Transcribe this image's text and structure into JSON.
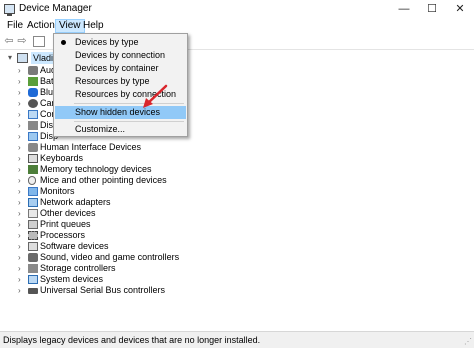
{
  "window": {
    "title": "Device Manager",
    "minimize_glyph": "—",
    "maximize_glyph": "☐",
    "close_glyph": "✕"
  },
  "menu": {
    "file": "File",
    "action": "Action",
    "view": "View",
    "help": "Help"
  },
  "view_menu": {
    "items": [
      {
        "label": "Devices by type",
        "selected": true
      },
      {
        "label": "Devices by connection"
      },
      {
        "label": "Devices by container"
      },
      {
        "label": "Resources by type"
      },
      {
        "label": "Resources by connection"
      },
      {
        "label": "Show hidden devices",
        "highlighted": true
      },
      {
        "label": "Customize..."
      }
    ]
  },
  "tree": {
    "root_label": "Vladimi",
    "partial_labels": [
      "Aud",
      "Batt",
      "Blue",
      "Cam",
      "Com",
      "Disk",
      "Disp"
    ],
    "items": [
      {
        "label": "Human Interface Devices",
        "icon": "hid-icon"
      },
      {
        "label": "Keyboards",
        "icon": "keyboard-icon"
      },
      {
        "label": "Memory technology devices",
        "icon": "memory-icon"
      },
      {
        "label": "Mice and other pointing devices",
        "icon": "mouse-icon"
      },
      {
        "label": "Monitors",
        "icon": "monitor-icon"
      },
      {
        "label": "Network adapters",
        "icon": "network-icon"
      },
      {
        "label": "Other devices",
        "icon": "other-devices-icon"
      },
      {
        "label": "Print queues",
        "icon": "printer-icon"
      },
      {
        "label": "Processors",
        "icon": "processor-icon"
      },
      {
        "label": "Software devices",
        "icon": "software-icon"
      },
      {
        "label": "Sound, video and game controllers",
        "icon": "sound-icon"
      },
      {
        "label": "Storage controllers",
        "icon": "storage-icon"
      },
      {
        "label": "System devices",
        "icon": "system-icon"
      },
      {
        "label": "Universal Serial Bus controllers",
        "icon": "usb-icon"
      }
    ]
  },
  "status": {
    "text": "Displays legacy devices and devices that are no longer installed."
  },
  "colors": {
    "menu_highlight": "#91c9f7",
    "annotation_arrow": "#d9262c"
  }
}
